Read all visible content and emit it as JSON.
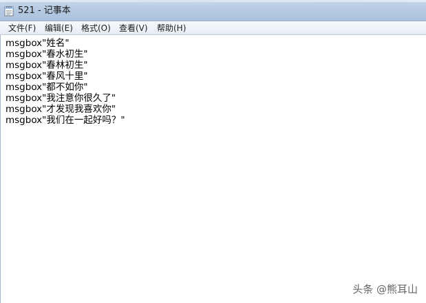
{
  "window": {
    "title": "521 - 记事本",
    "icon": "notepad-icon"
  },
  "menu": {
    "items": [
      {
        "label": "文件(F)"
      },
      {
        "label": "编辑(E)"
      },
      {
        "label": "格式(O)"
      },
      {
        "label": "查看(V)"
      },
      {
        "label": "帮助(H)"
      }
    ]
  },
  "editor": {
    "lines": [
      "msgbox\"姓名\"",
      "msgbox\"春水初生\"",
      "msgbox\"春林初生\"",
      "msgbox\"春风十里\"",
      "msgbox\"都不如你\"",
      "msgbox\"我注意你很久了\"",
      "msgbox\"才发现我喜欢你\"",
      "msgbox\"我们在一起好吗？\""
    ]
  },
  "watermark": {
    "text": "头条 @熊耳山"
  }
}
